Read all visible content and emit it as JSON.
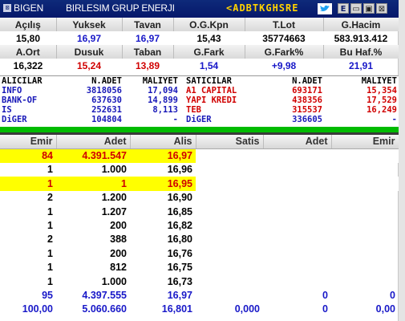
{
  "window": {
    "symbol": "BIGEN",
    "company": "BIRLESIM GRUP ENERJI",
    "ticker": "<ADBTKGHSRE",
    "e_label": "E",
    "minimize": "▭",
    "restore": "▣",
    "close": "⊠",
    "sym_icon": "⊠"
  },
  "quote1": {
    "headers": [
      "Açılış",
      "Yuksek",
      "Tavan",
      "O.G.Kpn",
      "T.Lot",
      "G.Hacim"
    ],
    "values": [
      "15,80",
      "16,97",
      "16,97",
      "15,43",
      "35774663",
      "583.913.412"
    ]
  },
  "quote2": {
    "headers": [
      "A.Ort",
      "Dusuk",
      "Taban",
      "G.Fark",
      "G.Fark%",
      "Bu Haf.%"
    ],
    "values": [
      "16,322",
      "15,24",
      "13,89",
      "1,54",
      "+9,98",
      "21,91"
    ]
  },
  "brokers": {
    "headers": [
      "ALICILAR",
      "N.ADET",
      "MALIYET",
      "SATICILAR",
      "N.ADET",
      "MALIYET"
    ],
    "rows": [
      [
        "INFO",
        "3818056",
        "17,094",
        "A1 CAPITAL",
        "693171",
        "15,354"
      ],
      [
        "BANK-OF",
        "637630",
        "14,899",
        "YAPI KREDI",
        "438356",
        "17,529"
      ],
      [
        "IS",
        "252631",
        "8,113",
        "TEB",
        "315537",
        "16,249"
      ],
      [
        "DiGER",
        "104804",
        "-",
        "DiGER",
        "336605",
        "-"
      ]
    ]
  },
  "book": {
    "headers": [
      "Emir",
      "Adet",
      "Alis",
      "Satis",
      "Adet",
      "Emir"
    ],
    "rows": [
      [
        "84",
        "4.391.547",
        "16,97",
        "",
        "",
        ""
      ],
      [
        "1",
        "1.000",
        "16,96",
        "",
        "",
        ""
      ],
      [
        "1",
        "1",
        "16,95",
        "",
        "",
        ""
      ],
      [
        "2",
        "1.200",
        "16,90",
        "",
        "",
        ""
      ],
      [
        "1",
        "1.207",
        "16,85",
        "",
        "",
        ""
      ],
      [
        "1",
        "200",
        "16,82",
        "",
        "",
        ""
      ],
      [
        "2",
        "388",
        "16,80",
        "",
        "",
        ""
      ],
      [
        "1",
        "200",
        "16,76",
        "",
        "",
        ""
      ],
      [
        "1",
        "812",
        "16,75",
        "",
        "",
        ""
      ],
      [
        "1",
        "1.000",
        "16,73",
        "",
        "",
        ""
      ],
      [
        "95",
        "4.397.555",
        "16,97",
        "",
        "0",
        "0"
      ],
      [
        "100,00",
        "5.060.660",
        "16,801",
        "0,000",
        "0",
        "0,00"
      ]
    ]
  },
  "colors": {
    "title_bg": "#06186a",
    "ticker": "#ffd200",
    "highlight": "#ffff00",
    "green_bar": "#00bb00",
    "red": "#d00000",
    "blue": "#1818c8"
  }
}
